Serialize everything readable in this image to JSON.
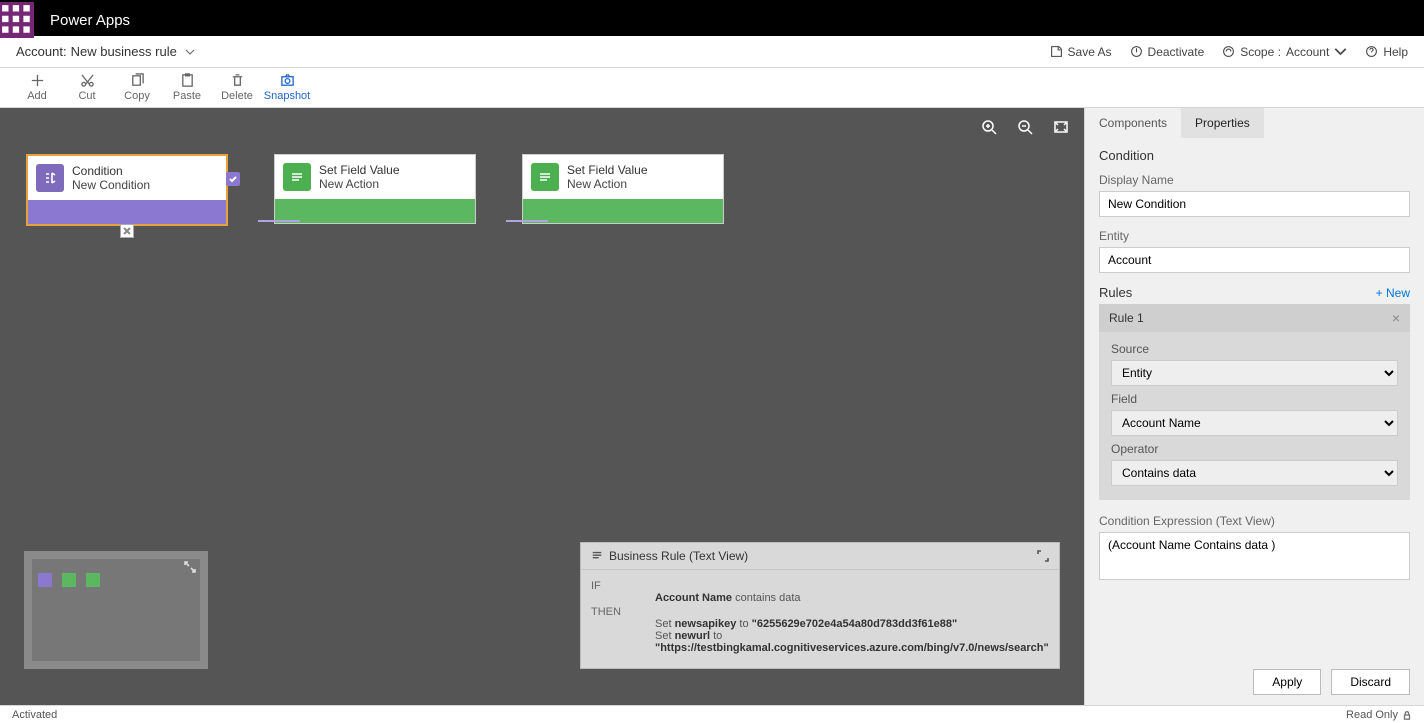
{
  "header": {
    "app_name": "Power Apps"
  },
  "rulebar": {
    "entity": "Account:",
    "rule_name": "New business rule",
    "actions": {
      "save_as": "Save As",
      "deactivate": "Deactivate",
      "scope_label": "Scope :",
      "scope_value": "Account",
      "help": "Help"
    }
  },
  "toolbar": {
    "add": "Add",
    "cut": "Cut",
    "copy": "Copy",
    "paste": "Paste",
    "delete": "Delete",
    "snapshot": "Snapshot"
  },
  "canvas": {
    "nodes": [
      {
        "kind": "condition",
        "title": "Condition",
        "subtitle": "New Condition"
      },
      {
        "kind": "action",
        "title": "Set Field Value",
        "subtitle": "New Action"
      },
      {
        "kind": "action",
        "title": "Set Field Value",
        "subtitle": "New Action"
      }
    ]
  },
  "textview": {
    "title": "Business Rule (Text View)",
    "if_label": "IF",
    "then_label": "THEN",
    "if_text_bold": "Account Name",
    "if_text_rest": " contains data",
    "then_lines": [
      {
        "pre": "Set ",
        "b1": "newsapikey",
        "mid": " to ",
        "q": "\"6255629e702e4a54a80d783dd3f61e88\""
      },
      {
        "pre": "Set ",
        "b1": "newurl",
        "mid": " to ",
        "q": "\"https://testbingkamal.cognitiveservices.azure.com/bing/v7.0/news/search\""
      }
    ]
  },
  "sidepanel": {
    "tabs": {
      "components": "Components",
      "properties": "Properties"
    },
    "section_title": "Condition",
    "display_name_label": "Display Name",
    "display_name_value": "New Condition",
    "entity_label": "Entity",
    "entity_value": "Account",
    "rules_label": "Rules",
    "new_label": "+ New",
    "rule_title": "Rule 1",
    "source_label": "Source",
    "source_value": "Entity",
    "field_label": "Field",
    "field_value": "Account Name",
    "operator_label": "Operator",
    "operator_value": "Contains data",
    "expr_label": "Condition Expression (Text View)",
    "expr_value": "(Account Name Contains data )",
    "apply": "Apply",
    "discard": "Discard"
  },
  "statusbar": {
    "left": "Activated",
    "right": "Read Only"
  }
}
